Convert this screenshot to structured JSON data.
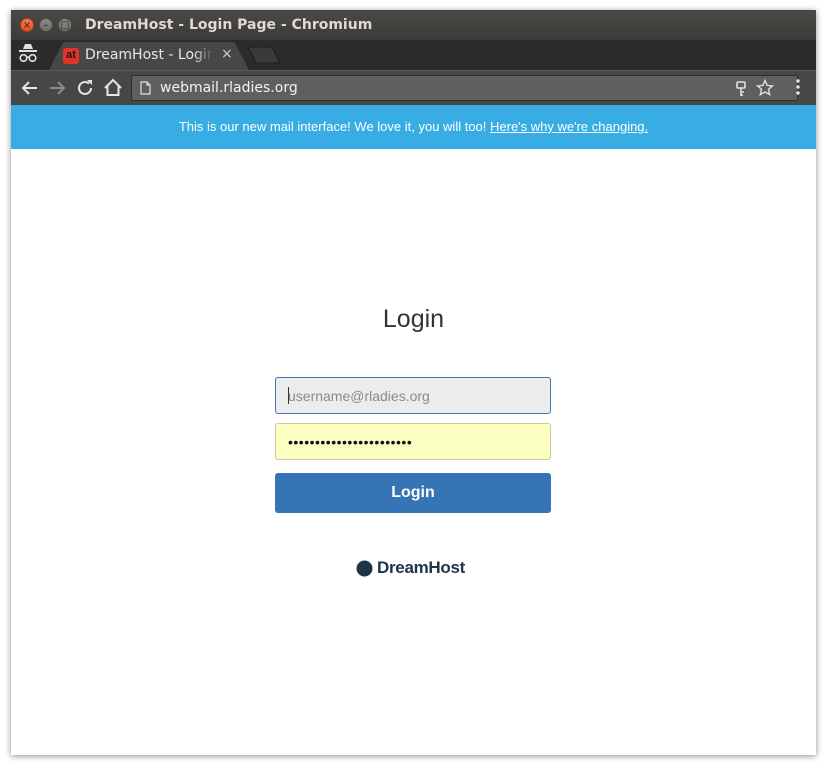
{
  "window": {
    "title": "DreamHost - Login Page - Chromium",
    "controls": {
      "close": "×",
      "minimize": "–",
      "maximize": "□"
    }
  },
  "tab": {
    "title": "DreamHost - Login Page",
    "favicon_text": "at",
    "close_glyph": "×"
  },
  "toolbar": {
    "url": "webmail.rladies.org"
  },
  "banner": {
    "text": "This is our new mail interface! We love it, you will too! ",
    "link_text": "Here's why we're changing."
  },
  "login": {
    "title": "Login",
    "username_placeholder": "username@rladies.org",
    "username_value": "",
    "password_value": "•••••••••••••••••••••••",
    "button_label": "Login"
  },
  "footer": {
    "brand": "DreamHost"
  },
  "colors": {
    "banner": "#38ade3",
    "button": "#3575b5",
    "password_autofill": "#fbffc2",
    "brand_text": "#1f3446"
  },
  "icons": [
    "incognito-icon",
    "back-icon",
    "forward-icon",
    "reload-icon",
    "home-icon",
    "page-icon",
    "key-icon",
    "star-icon",
    "menu-icon",
    "dreamhost-logo-icon"
  ]
}
